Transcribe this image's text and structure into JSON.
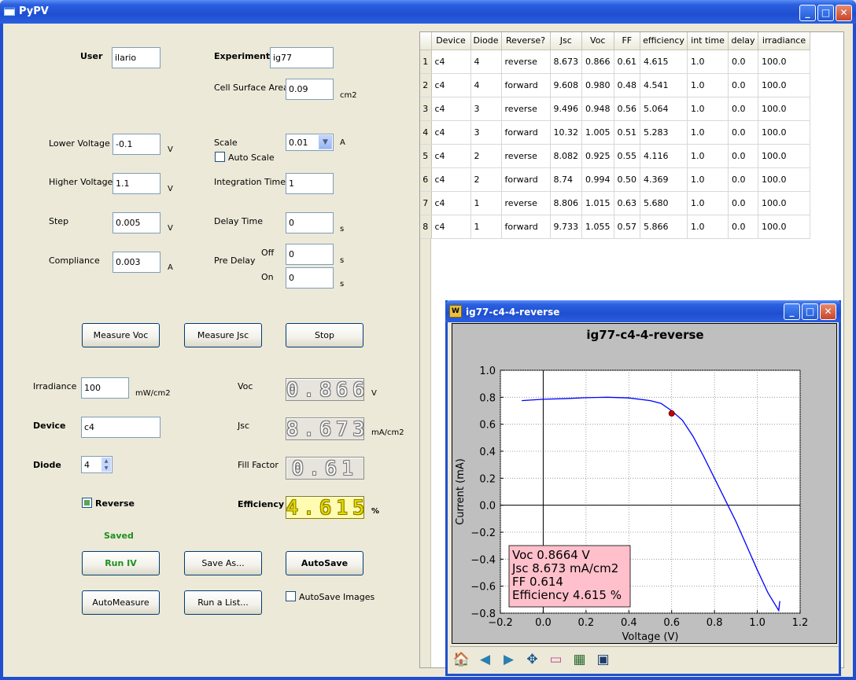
{
  "window": {
    "title": "PyPV"
  },
  "form": {
    "user_label": "User",
    "user_value": "ilario",
    "experiment_label": "Experiment",
    "experiment_value": "ig77",
    "cell_area_label": "Cell Surface Area",
    "cell_area_value": "0.09",
    "cell_area_unit": "cm2",
    "lower_voltage_label": "Lower Voltage",
    "lower_voltage_value": "-0.1",
    "lower_voltage_unit": "V",
    "higher_voltage_label": "Higher Voltage",
    "higher_voltage_value": "1.1",
    "higher_voltage_unit": "V",
    "step_label": "Step",
    "step_value": "0.005",
    "step_unit": "V",
    "compliance_label": "Compliance",
    "compliance_value": "0.003",
    "compliance_unit": "A",
    "scale_label": "Scale",
    "scale_value": "0.01",
    "scale_unit": "A",
    "auto_scale_label": "Auto Scale",
    "integration_label": "Integration Time",
    "integration_value": "1",
    "delay_label": "Delay Time",
    "delay_value": "0",
    "delay_unit": "s",
    "predelay_label": "Pre Delay",
    "off_label": "Off",
    "off_value": "0",
    "off_unit": "s",
    "on_label": "On",
    "on_value": "0",
    "on_unit": "s"
  },
  "buttons": {
    "measure_voc": "Measure Voc",
    "measure_jsc": "Measure Jsc",
    "stop": "Stop",
    "run_iv": "Run IV",
    "save_as": "Save As...",
    "autosave": "AutoSave",
    "automeasure": "AutoMeasure",
    "run_list": "Run a List...",
    "autosave_images": "AutoSave Images"
  },
  "measure": {
    "irradiance_label": "Irradiance",
    "irradiance_value": "100",
    "irradiance_unit": "mW/cm2",
    "device_label": "Device",
    "device_value": "c4",
    "diode_label": "Diode",
    "diode_value": "4",
    "reverse_label": "Reverse",
    "reverse_checked": true,
    "saved_label": "Saved",
    "voc_label": "Voc",
    "voc_value": "0.866",
    "voc_unit": "V",
    "jsc_label": "Jsc",
    "jsc_value": "8.673",
    "jsc_unit": "mA/cm2",
    "ff_label": "Fill Factor",
    "ff_value": "0.61",
    "eff_label": "Efficiency",
    "eff_value": "4.615",
    "eff_unit": "%"
  },
  "table": {
    "headers": [
      "Device",
      "Diode",
      "Reverse?",
      "Jsc",
      "Voc",
      "FF",
      "efficiency",
      "int time",
      "delay",
      "irradiance"
    ],
    "rows": [
      {
        "n": "1",
        "cells": [
          "c4",
          "4",
          "reverse",
          "8.673",
          "0.866",
          "0.61",
          "4.615",
          "1.0",
          "0.0",
          "100.0"
        ]
      },
      {
        "n": "2",
        "cells": [
          "c4",
          "4",
          "forward",
          "9.608",
          "0.980",
          "0.48",
          "4.541",
          "1.0",
          "0.0",
          "100.0"
        ]
      },
      {
        "n": "3",
        "cells": [
          "c4",
          "3",
          "reverse",
          "9.496",
          "0.948",
          "0.56",
          "5.064",
          "1.0",
          "0.0",
          "100.0"
        ]
      },
      {
        "n": "4",
        "cells": [
          "c4",
          "3",
          "forward",
          "10.32",
          "1.005",
          "0.51",
          "5.283",
          "1.0",
          "0.0",
          "100.0"
        ]
      },
      {
        "n": "5",
        "cells": [
          "c4",
          "2",
          "reverse",
          "8.082",
          "0.925",
          "0.55",
          "4.116",
          "1.0",
          "0.0",
          "100.0"
        ]
      },
      {
        "n": "6",
        "cells": [
          "c4",
          "2",
          "forward",
          "8.74",
          "0.994",
          "0.50",
          "4.369",
          "1.0",
          "0.0",
          "100.0"
        ]
      },
      {
        "n": "7",
        "cells": [
          "c4",
          "1",
          "reverse",
          "8.806",
          "1.015",
          "0.63",
          "5.680",
          "1.0",
          "0.0",
          "100.0"
        ]
      },
      {
        "n": "8",
        "cells": [
          "c4",
          "1",
          "forward",
          "9.733",
          "1.055",
          "0.57",
          "5.866",
          "1.0",
          "0.0",
          "100.0"
        ]
      }
    ]
  },
  "plot_window": {
    "title": "ig77-c4-4-reverse"
  },
  "chart_data": {
    "type": "line",
    "title": "ig77-c4-4-reverse",
    "xlabel": "Voltage (V)",
    "ylabel": "Current (mA)",
    "xlim": [
      -0.2,
      1.2
    ],
    "ylim": [
      -0.8,
      1.0
    ],
    "xticks": [
      "−0.2",
      "0.0",
      "0.2",
      "0.4",
      "0.6",
      "0.8",
      "1.0",
      "1.2"
    ],
    "yticks": [
      "1.0",
      "0.8",
      "0.6",
      "0.4",
      "0.2",
      "0.0",
      "−0.2",
      "−0.4",
      "−0.6",
      "−0.8"
    ],
    "grid": true,
    "series": [
      {
        "color": "#0000ff",
        "x": [
          -0.1,
          0.0,
          0.1,
          0.2,
          0.3,
          0.4,
          0.5,
          0.55,
          0.6,
          0.65,
          0.7,
          0.75,
          0.8,
          0.85,
          0.9,
          0.95,
          1.0,
          1.05,
          1.1,
          1.105
        ],
        "y": [
          0.775,
          0.785,
          0.79,
          0.797,
          0.8,
          0.795,
          0.775,
          0.755,
          0.7,
          0.63,
          0.51,
          0.36,
          0.2,
          0.04,
          -0.12,
          -0.3,
          -0.48,
          -0.65,
          -0.78,
          -0.71
        ]
      }
    ],
    "marker": {
      "x": 0.6,
      "y": 0.68,
      "color": "#cc0000"
    },
    "annotation": [
      "Voc 0.8664 V",
      "Jsc 8.673 mA/cm2",
      "FF 0.614",
      "Efficiency 4.615 %"
    ]
  },
  "toolbar": {
    "icons": [
      "home-icon",
      "back-icon",
      "forward-icon",
      "pan-icon",
      "zoom-icon",
      "configure-icon",
      "save-icon"
    ]
  }
}
